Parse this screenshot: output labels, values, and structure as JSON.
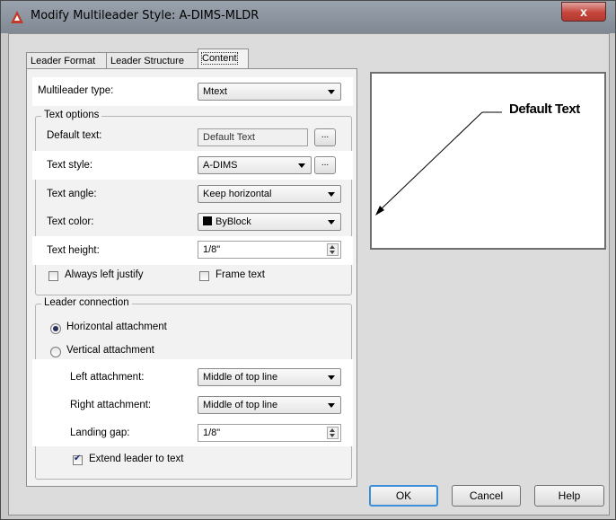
{
  "window": {
    "title": "Modify Multileader Style: A-DIMS-MLDR",
    "close_label": "x"
  },
  "tabs": [
    {
      "label": "Leader Format",
      "active": false
    },
    {
      "label": "Leader Structure",
      "active": false
    },
    {
      "label": "Content",
      "active": true
    }
  ],
  "content": {
    "multileader_type": {
      "label": "Multileader type:",
      "value": "Mtext"
    },
    "text_options": {
      "group_title": "Text options",
      "default_text": {
        "label": "Default text:",
        "value": "Default Text",
        "button": "..."
      },
      "text_style": {
        "label": "Text style:",
        "value": "A-DIMS",
        "button": "..."
      },
      "text_angle": {
        "label": "Text angle:",
        "value": "Keep horizontal"
      },
      "text_color": {
        "label": "Text color:",
        "value": "ByBlock",
        "swatch": "#000000"
      },
      "text_height": {
        "label": "Text height:",
        "value": "1/8\""
      },
      "always_left_justify": {
        "label": "Always left justify",
        "checked": false
      },
      "frame_text": {
        "label": "Frame text",
        "checked": false
      }
    },
    "leader_connection": {
      "group_title": "Leader connection",
      "horizontal": {
        "label": "Horizontal attachment",
        "selected": true
      },
      "vertical": {
        "label": "Vertical attachment",
        "selected": false
      },
      "left_attachment": {
        "label": "Left attachment:",
        "value": "Middle of top line"
      },
      "right_attachment": {
        "label": "Right attachment:",
        "value": "Middle of top line"
      },
      "landing_gap": {
        "label": "Landing gap:",
        "value": "1/8\""
      },
      "extend_leader": {
        "label": "Extend leader to text",
        "checked": true
      }
    }
  },
  "preview": {
    "text": "Default Text"
  },
  "buttons": {
    "ok": "OK",
    "cancel": "Cancel",
    "help": "Help"
  },
  "colors": {
    "accent": "#3b8fd8",
    "close": "#c5453b",
    "autocad_icon": "#c0392b"
  }
}
